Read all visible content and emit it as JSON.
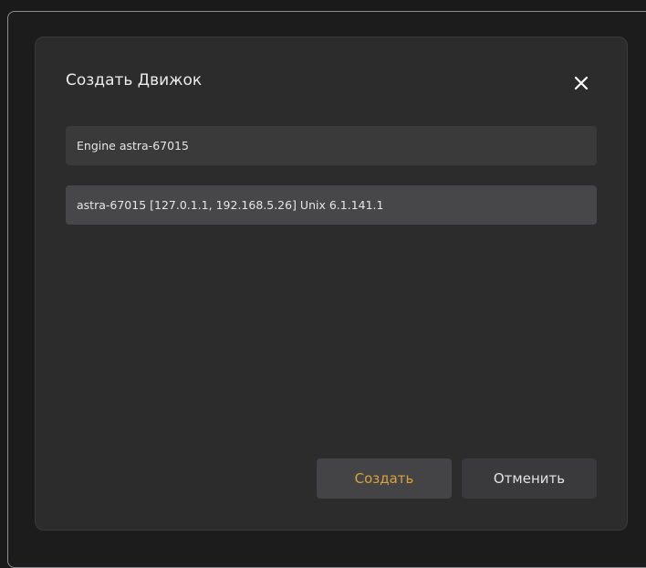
{
  "dialog": {
    "title": "Создать Движок",
    "close_icon": "close-icon",
    "engine_name_value": "Engine astra-67015",
    "host_select_value": "astra-67015 [127.0.1.1, 192.168.5.26] Unix 6.1.141.1",
    "create_label": "Создать",
    "cancel_label": "Отменить"
  },
  "colors": {
    "dialog_bg": "#2c2c2d",
    "field_bg": "#3a3a3b",
    "select_bg": "#47474a",
    "accent": "#d9a23c",
    "text": "#e6e6e6"
  }
}
